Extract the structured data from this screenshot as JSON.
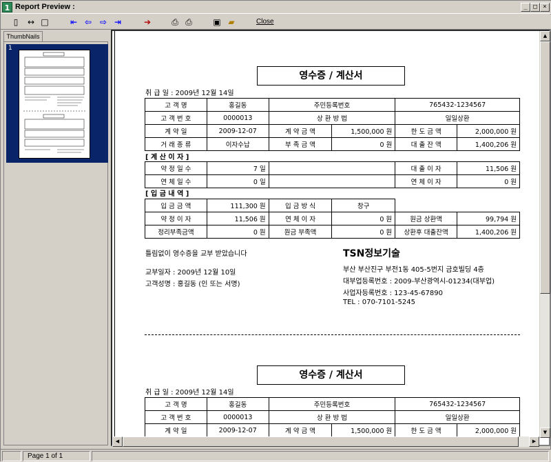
{
  "window": {
    "title": "Report Preview :",
    "app_icon": "1"
  },
  "toolbar": {
    "close_label": "Close"
  },
  "thumbnails": {
    "tab_label": "ThumbNails",
    "page_number": "1"
  },
  "status": {
    "page_info": "Page 1 of 1"
  },
  "receipt": {
    "title": "영수증 / 계산서",
    "issue_date": "취 급 일 : 2009년 12월 14일",
    "info_rows": [
      [
        "고 객 명",
        "홍길동",
        "주민등록번호",
        "765432-1234567"
      ],
      [
        "고 객 번 호",
        "0000013",
        "상 환 방 법",
        "일일상환"
      ]
    ],
    "contract_rows": [
      [
        "계 약 일",
        "2009-12-07",
        "계 약 금 액",
        "1,500,000 원",
        "한 도 금 액",
        "2,000,000 원"
      ],
      [
        "거 래 종 류",
        "이자수납",
        "부 족 금 액",
        "0 원",
        "대 출 잔 액",
        "1,400,206 원"
      ]
    ],
    "interest_calc": {
      "heading": "[ 계 산 이 자 ]",
      "rows": [
        [
          "약 정 일 수",
          "7 일",
          "",
          "",
          "대 출 이 자",
          "11,506 원"
        ],
        [
          "연 체 일 수",
          "0 일",
          "",
          "",
          "연 체 이 자",
          "0 원"
        ]
      ]
    },
    "payment": {
      "heading": "[ 입 금 내 역 ]",
      "row1": [
        "입 금 금 액",
        "111,300 원",
        "입 금 방 식",
        "창구"
      ],
      "rows": [
        [
          "약 정 이 자",
          "11,506 원",
          "연 체 이 자",
          "0 원",
          "원금 상환액",
          "99,794 원"
        ],
        [
          "정리부족금액",
          "0 원",
          "원금 부족액",
          "0 원",
          "상환후 대출잔액",
          "1,400,206 원"
        ]
      ]
    },
    "footer": {
      "statement": "틀림없이 영수증을 교부 받았습니다",
      "delivery_date": "교부일자 :  2009년 12월 10일",
      "customer_sign": "고객성명 :   홍길동   (인 또는 서명)",
      "company_name": "TSN정보기술",
      "address": "부산 부산진구 부전1동 405-5번지 금호빌딩 4층",
      "loan_reg": "대부업등록번호 : 2009-부산광역시-01234(대부업)",
      "biz_reg": "사업자등록번호 : 123-45-67890",
      "tel": "TEL : 070-7101-5245"
    }
  },
  "colors": {
    "selection": "#0a246a",
    "chrome": "#d4d0c8",
    "tool_blue": "#1010ff"
  }
}
